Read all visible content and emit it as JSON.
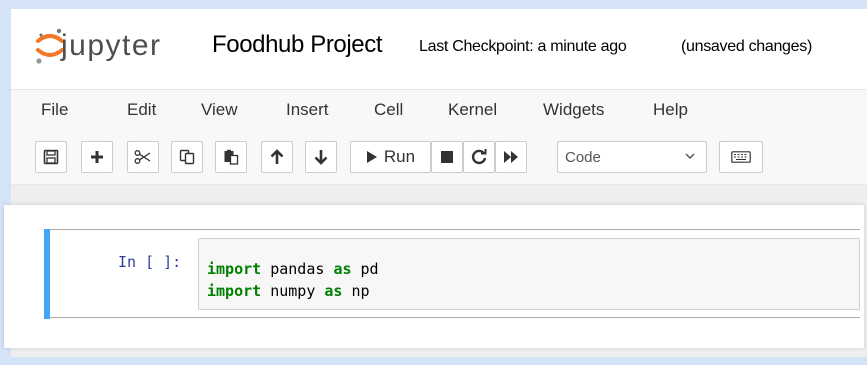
{
  "header": {
    "logo_text": "jupyter",
    "notebook_title": "Foodhub Project",
    "checkpoint": "Last Checkpoint: a minute ago",
    "autosave": "(unsaved changes)"
  },
  "menu": [
    "File",
    "Edit",
    "View",
    "Insert",
    "Cell",
    "Kernel",
    "Widgets",
    "Help"
  ],
  "toolbar": {
    "run_label": "Run",
    "cell_type": "Code",
    "cell_type_options": [
      "Code"
    ]
  },
  "cell": {
    "prompt": "In [ ]:",
    "lines": [
      {
        "keyword": "import",
        "module": "pandas",
        "as_kw": "as",
        "alias": "pd"
      },
      {
        "keyword": "import",
        "module": "numpy",
        "as_kw": "as",
        "alias": "np"
      }
    ]
  },
  "colors": {
    "logo_orange": "#f37726",
    "cell_selected_bar": "#42a5f5",
    "keyword_green": "#008000",
    "prompt_blue": "#303f9f"
  }
}
